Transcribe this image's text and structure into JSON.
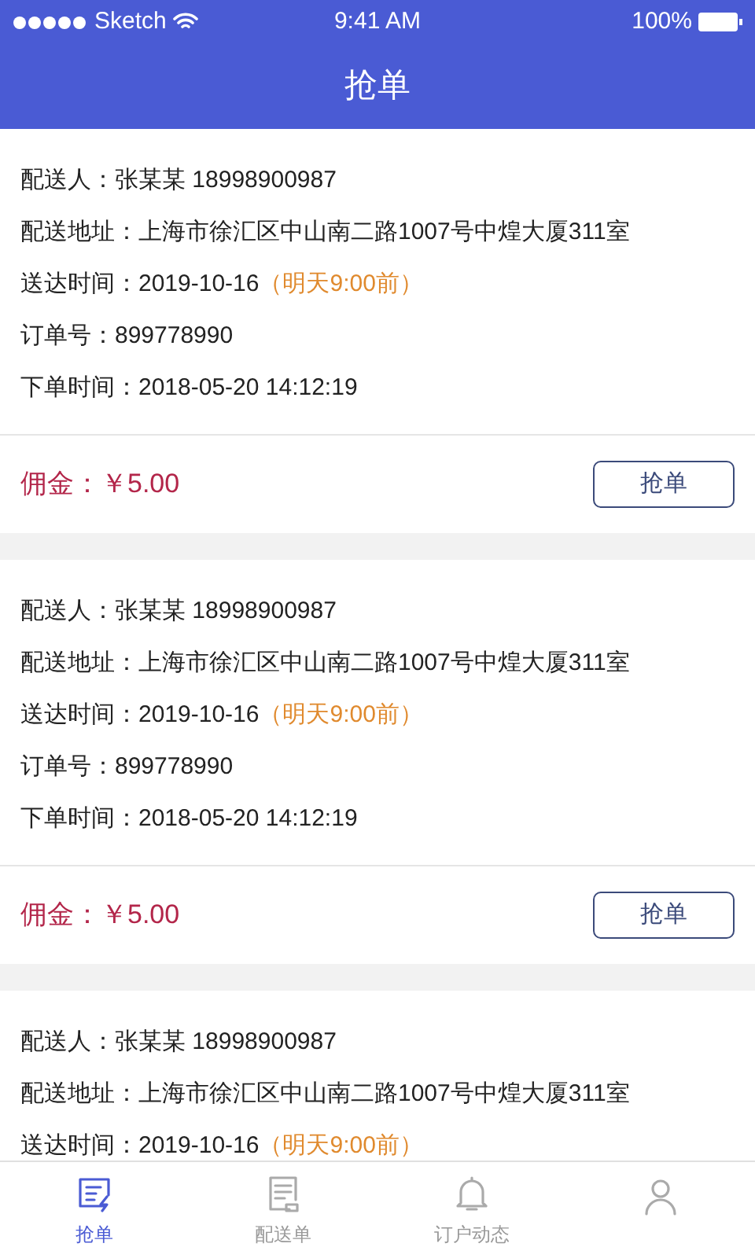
{
  "status_bar": {
    "carrier": "Sketch",
    "time": "9:41 AM",
    "battery": "100%"
  },
  "header": {
    "title": "抢单"
  },
  "orders": [
    {
      "rows": [
        {
          "label": "配送人：",
          "value": "张某某  18998900987"
        },
        {
          "label": "配送地址：",
          "value": "上海市徐汇区中山南二路1007号中煌大厦311室"
        },
        {
          "label": "送达时间：",
          "value": "2019-10-16",
          "note": "（明天9:00前）"
        },
        {
          "label": "订单号：",
          "value": "899778990"
        },
        {
          "label": "下单时间：",
          "value": "2018-05-20 14:12:19"
        }
      ],
      "commission_label": "佣金：",
      "commission": "￥5.00",
      "button": "抢单"
    },
    {
      "rows": [
        {
          "label": "配送人：",
          "value": "张某某  18998900987"
        },
        {
          "label": "配送地址：",
          "value": "上海市徐汇区中山南二路1007号中煌大厦311室"
        },
        {
          "label": "送达时间：",
          "value": "2019-10-16",
          "note": "（明天9:00前）"
        },
        {
          "label": "订单号：",
          "value": "899778990"
        },
        {
          "label": "下单时间：",
          "value": "2018-05-20 14:12:19"
        }
      ],
      "commission_label": "佣金：",
      "commission": "￥5.00",
      "button": "抢单"
    },
    {
      "rows": [
        {
          "label": "配送人：",
          "value": "张某某  18998900987"
        },
        {
          "label": "配送地址：",
          "value": "上海市徐汇区中山南二路1007号中煌大厦311室"
        },
        {
          "label": "送达时间：",
          "value": "2019-10-16",
          "note": "（明天9:00前）"
        }
      ]
    }
  ],
  "tabs": [
    {
      "label": "抢单",
      "kind": "grab",
      "selected": true
    },
    {
      "label": "配送单",
      "kind": "list",
      "selected": false
    },
    {
      "label": "订户动态",
      "kind": "bell",
      "selected": false
    },
    {
      "kind": "user",
      "selected": false
    }
  ]
}
